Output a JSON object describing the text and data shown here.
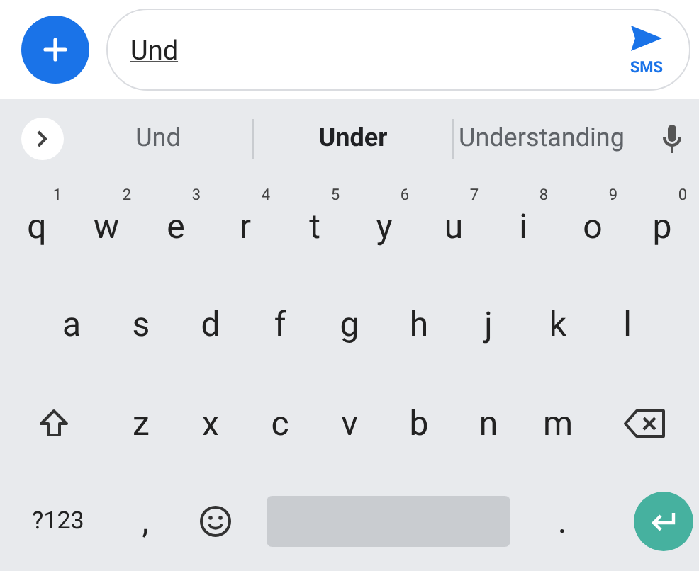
{
  "compose": {
    "value": "Und",
    "send_label": "SMS"
  },
  "suggestions": [
    {
      "text": "Und",
      "selected": false
    },
    {
      "text": "Under",
      "selected": true
    },
    {
      "text": "Understanding",
      "selected": false
    }
  ],
  "key_rows": [
    [
      {
        "kind": "letter",
        "label": "q",
        "hint": "1"
      },
      {
        "kind": "letter",
        "label": "w",
        "hint": "2"
      },
      {
        "kind": "letter",
        "label": "e",
        "hint": "3"
      },
      {
        "kind": "letter",
        "label": "r",
        "hint": "4"
      },
      {
        "kind": "letter",
        "label": "t",
        "hint": "5"
      },
      {
        "kind": "letter",
        "label": "y",
        "hint": "6"
      },
      {
        "kind": "letter",
        "label": "u",
        "hint": "7"
      },
      {
        "kind": "letter",
        "label": "i",
        "hint": "8"
      },
      {
        "kind": "letter",
        "label": "o",
        "hint": "9"
      },
      {
        "kind": "letter",
        "label": "p",
        "hint": "0"
      }
    ],
    [
      {
        "kind": "letter",
        "label": "a"
      },
      {
        "kind": "letter",
        "label": "s"
      },
      {
        "kind": "letter",
        "label": "d"
      },
      {
        "kind": "letter",
        "label": "f"
      },
      {
        "kind": "letter",
        "label": "g"
      },
      {
        "kind": "letter",
        "label": "h"
      },
      {
        "kind": "letter",
        "label": "j"
      },
      {
        "kind": "letter",
        "label": "k"
      },
      {
        "kind": "letter",
        "label": "l"
      }
    ],
    [
      {
        "kind": "shift"
      },
      {
        "kind": "letter",
        "label": "z"
      },
      {
        "kind": "letter",
        "label": "x"
      },
      {
        "kind": "letter",
        "label": "c"
      },
      {
        "kind": "letter",
        "label": "v"
      },
      {
        "kind": "letter",
        "label": "b"
      },
      {
        "kind": "letter",
        "label": "n"
      },
      {
        "kind": "letter",
        "label": "m"
      },
      {
        "kind": "backspace"
      }
    ],
    [
      {
        "kind": "symbols",
        "label": "?123"
      },
      {
        "kind": "letter",
        "label": ","
      },
      {
        "kind": "emoji"
      },
      {
        "kind": "space"
      },
      {
        "kind": "letter",
        "label": "."
      },
      {
        "kind": "enter"
      }
    ]
  ]
}
